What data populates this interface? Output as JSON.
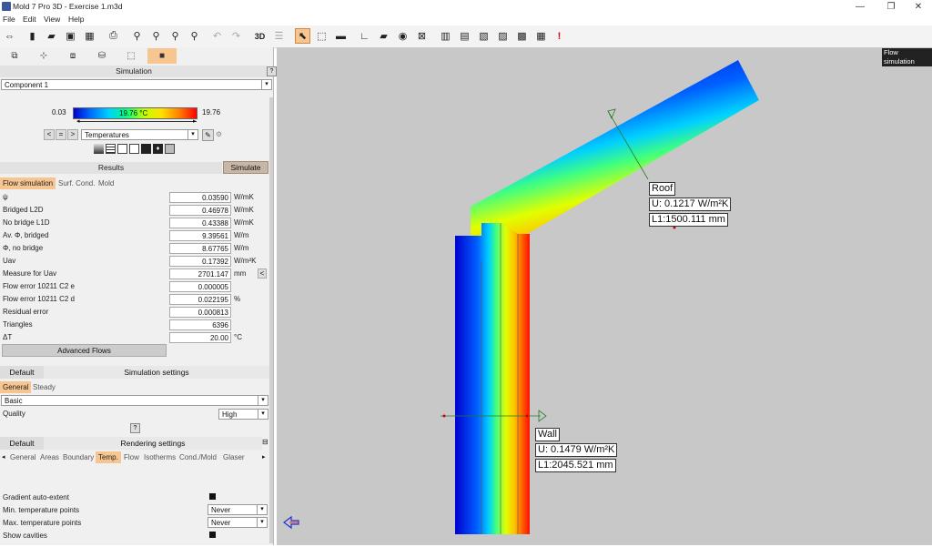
{
  "window": {
    "title": "Mold 7 Pro 3D - Exercise 1.m3d"
  },
  "menu": [
    "File",
    "Edit",
    "View",
    "Help"
  ],
  "simulation": {
    "header": "Simulation",
    "component": "Component 1",
    "scale_min": "0.03",
    "scale_max": "19.76",
    "scale_marker": "19.76 °C",
    "view_mode": "Temperatures"
  },
  "results": {
    "header": "Results",
    "simulate_label": "Simulate",
    "tabs": [
      "Flow simulation",
      "Surf. Cond.",
      "Mold"
    ],
    "rows": [
      {
        "label": "ψ",
        "value": "0.03590",
        "unit": "W/mK"
      },
      {
        "label": "Bridged L2D",
        "value": "0.46978",
        "unit": "W/mK"
      },
      {
        "label": "No bridge L1D",
        "value": "0.43388",
        "unit": "W/mK"
      },
      {
        "label": "Av. Φ, bridged",
        "value": "9.39561",
        "unit": "W/m"
      },
      {
        "label": "Φ, no bridge",
        "value": "8.67765",
        "unit": "W/m"
      },
      {
        "label": "Uav",
        "value": "0.17392",
        "unit": "W/m²K"
      },
      {
        "label": "Measure for Uav",
        "value": "2701.147",
        "unit": "mm"
      },
      {
        "label": "Flow error 10211 C2 e",
        "value": "0.000005",
        "unit": ""
      },
      {
        "label": "Flow error 10211 C2 d",
        "value": "0.022195",
        "unit": "%"
      },
      {
        "label": "Residual error",
        "value": "0.000813",
        "unit": ""
      },
      {
        "label": "Triangles",
        "value": "6396",
        "unit": ""
      },
      {
        "label": "ΔT",
        "value": "20.00",
        "unit": "°C"
      }
    ],
    "advanced_flows": "Advanced Flows"
  },
  "sim_settings": {
    "default_label": "Default",
    "header": "Simulation settings",
    "tabs": [
      "General",
      "Steady"
    ],
    "mode": "Basic",
    "quality_label": "Quality",
    "quality_value": "High"
  },
  "render_settings": {
    "default_label": "Default",
    "header": "Rendering settings",
    "tabs": [
      "General",
      "Areas",
      "Boundary",
      "Temp.",
      "Flow",
      "Isotherms",
      "Cond./Mold",
      "Glaser"
    ],
    "gradient_label": "Gradient auto-extent",
    "min_label": "Min. temperature points",
    "min_value": "Never",
    "max_label": "Max. temperature points",
    "max_value": "Never",
    "cavities_label": "Show cavities"
  },
  "canvas": {
    "tooltip": "Flow simulation",
    "roof": {
      "name": "Roof",
      "u": "U: 0.1217 W/m²K",
      "l": "L1:1500.111 mm"
    },
    "wall": {
      "name": "Wall",
      "u": "U: 0.1479 W/m²K",
      "l": "L1:2045.521 mm"
    }
  }
}
